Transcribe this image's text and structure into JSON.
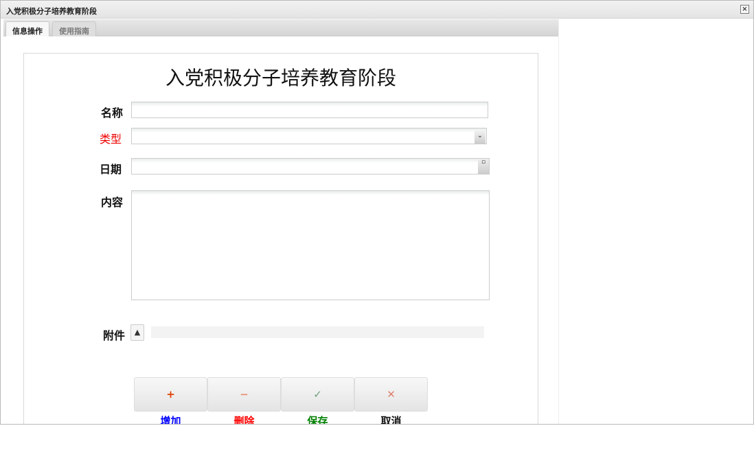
{
  "window": {
    "title": "入党积极分子培养教育阶段",
    "close_icon": "×"
  },
  "tabs": [
    {
      "label": "信息操作"
    },
    {
      "label": "使用指南"
    }
  ],
  "form": {
    "title": "入党积极分子培养教育阶段",
    "fields": {
      "name": {
        "label": "名称",
        "value": ""
      },
      "type": {
        "label": "类型",
        "value": ""
      },
      "date": {
        "label": "日期",
        "value": ""
      },
      "content": {
        "label": "内容",
        "value": ""
      },
      "attachment": {
        "label": "附件"
      }
    }
  },
  "buttons": [
    {
      "label": "增加",
      "icon": "+",
      "color": "#0000ff",
      "icon_color": "#e04000"
    },
    {
      "label": "删除",
      "icon": "−",
      "color": "#ff0000",
      "icon_color": "#e89070"
    },
    {
      "label": "保存",
      "icon": "✓",
      "color": "#008000",
      "icon_color": "#70a080"
    },
    {
      "label": "取消",
      "icon": "✕",
      "color": "#111111",
      "icon_color": "#e08070"
    }
  ]
}
